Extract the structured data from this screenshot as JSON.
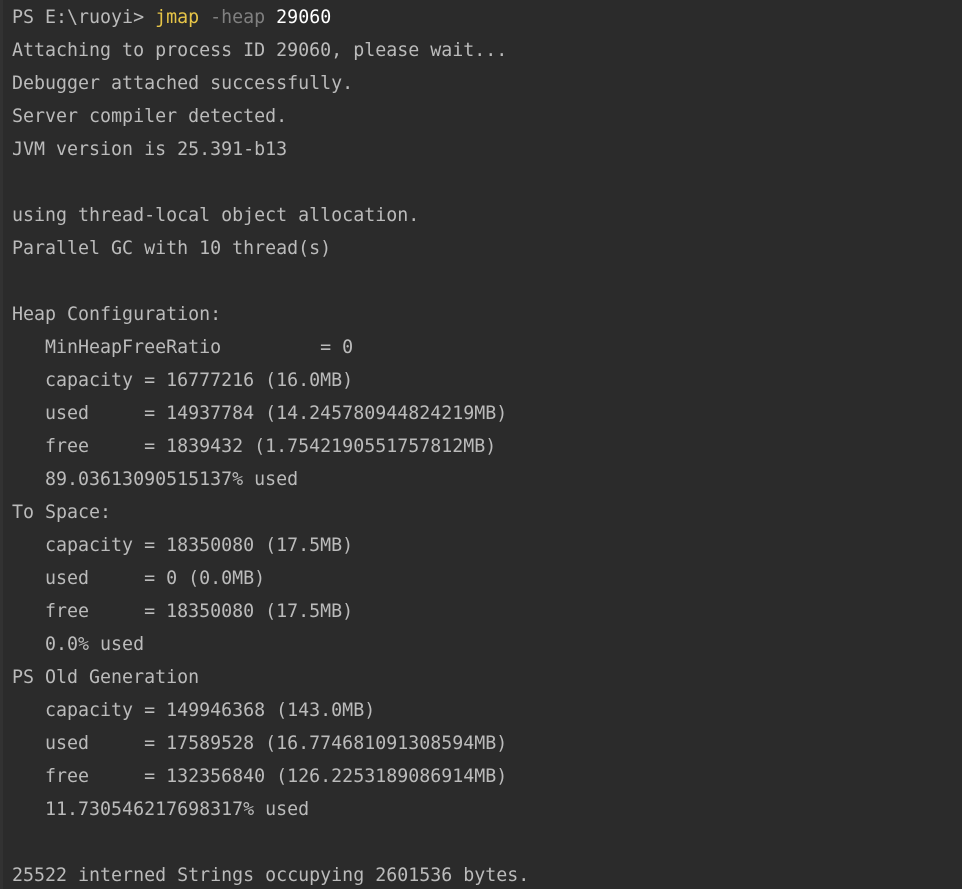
{
  "terminal": {
    "prompt": "PS E:\\ruoyi> ",
    "command": {
      "name": "jmap",
      "flag": " -heap",
      "arg": " 29060"
    },
    "lines": [
      "Attaching to process ID 29060, please wait...",
      "Debugger attached successfully.",
      "Server compiler detected.",
      "JVM version is 25.391-b13",
      "",
      "using thread-local object allocation.",
      "Parallel GC with 10 thread(s)",
      "",
      "Heap Configuration:",
      "   MinHeapFreeRatio         = 0",
      "   capacity = 16777216 (16.0MB)",
      "   used     = 14937784 (14.245780944824219MB)",
      "   free     = 1839432 (1.7542190551757812MB)",
      "   89.03613090515137% used",
      "To Space:",
      "   capacity = 18350080 (17.5MB)",
      "   used     = 0 (0.0MB)",
      "   free     = 18350080 (17.5MB)",
      "   0.0% used",
      "PS Old Generation",
      "   capacity = 149946368 (143.0MB)",
      "   used     = 17589528 (16.774681091308594MB)",
      "   free     = 132356840 (126.2253189086914MB)",
      "   11.730546217698317% used",
      "",
      "25522 interned Strings occupying 2601536 bytes."
    ]
  },
  "colors": {
    "background": "#2b2b2b",
    "text": "#bbbbbb",
    "command": "#e7c547",
    "flag": "#808080",
    "argument": "#ffffff"
  }
}
